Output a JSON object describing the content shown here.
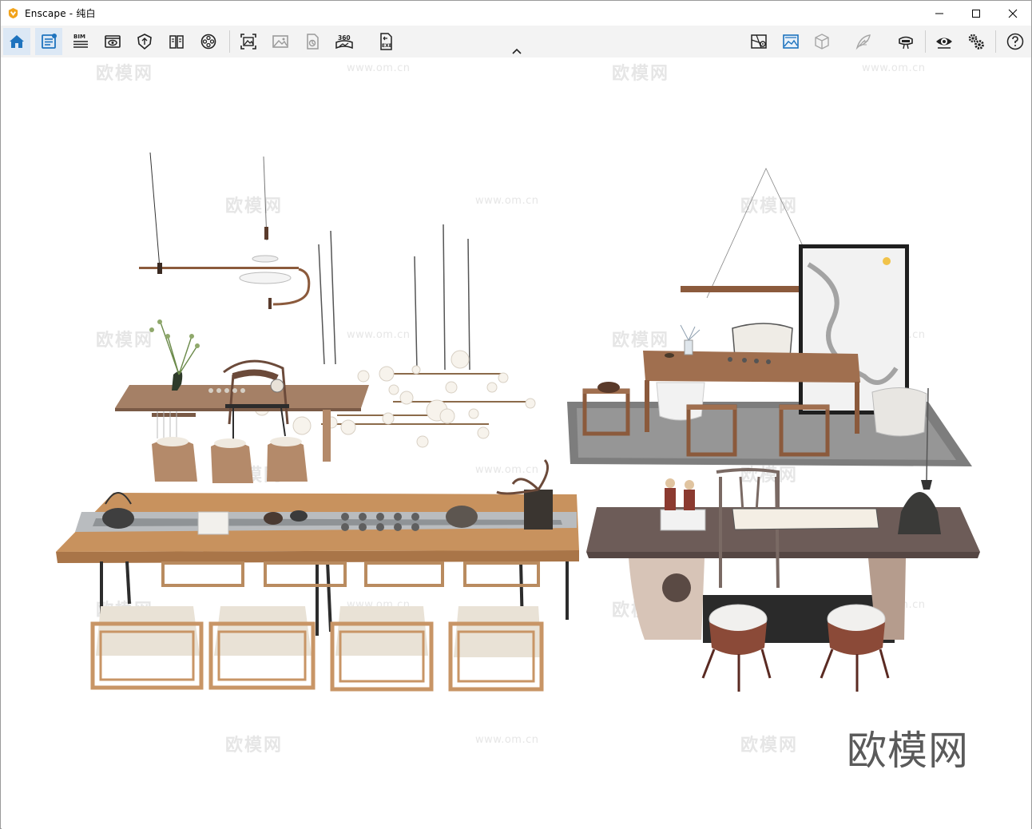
{
  "window": {
    "app_name": "Enscape",
    "title": "Enscape - 纯白"
  },
  "toolbar": {
    "bim_label": "BIM",
    "pano_label": "360",
    "exe_label": "EXE",
    "buttons_left": [
      {
        "name": "home-button",
        "icon": "home-icon",
        "active": true
      },
      {
        "name": "scene-info-button",
        "icon": "document-settings-icon",
        "active": true
      },
      {
        "name": "bim-button",
        "icon": "bim-icon",
        "active": false
      },
      {
        "name": "views-button",
        "icon": "view-eye-icon",
        "active": false
      },
      {
        "name": "atmosphere-button",
        "icon": "shield-icon",
        "active": false
      },
      {
        "name": "materials-button",
        "icon": "book-icon",
        "active": false
      },
      {
        "name": "video-editor-button",
        "icon": "film-reel-icon",
        "active": false
      },
      {
        "name": "screenshot-button",
        "icon": "capture-image-icon",
        "active": false
      },
      {
        "name": "batch-render-button",
        "icon": "image-icon",
        "active": false
      },
      {
        "name": "asset-library-button",
        "icon": "asset-icon",
        "active": false
      },
      {
        "name": "panorama-button",
        "icon": "panorama-360-icon",
        "active": false
      },
      {
        "name": "export-exe-button",
        "icon": "export-exe-icon",
        "active": false
      }
    ],
    "buttons_right": [
      {
        "name": "map-button",
        "icon": "map-icon"
      },
      {
        "name": "visual-settings-button",
        "icon": "landscape-icon"
      },
      {
        "name": "box-button",
        "icon": "cube-icon"
      },
      {
        "name": "feather-button",
        "icon": "feather-icon"
      },
      {
        "name": "vr-button",
        "icon": "vr-headset-icon"
      },
      {
        "name": "preview-button",
        "icon": "eye-icon"
      },
      {
        "name": "settings-button",
        "icon": "gears-icon"
      },
      {
        "name": "help-button",
        "icon": "help-icon"
      }
    ]
  },
  "colors": {
    "accent": "#1e73be",
    "toolbar_bg": "#f3f3f3",
    "icon": "#333333",
    "wood_light": "#d9a774",
    "wood_dark": "#6b4a3a",
    "watermark": "#e4e4e4"
  },
  "watermark": {
    "cn": "欧模网",
    "url": "www.om.cn",
    "brand": "欧模网"
  }
}
